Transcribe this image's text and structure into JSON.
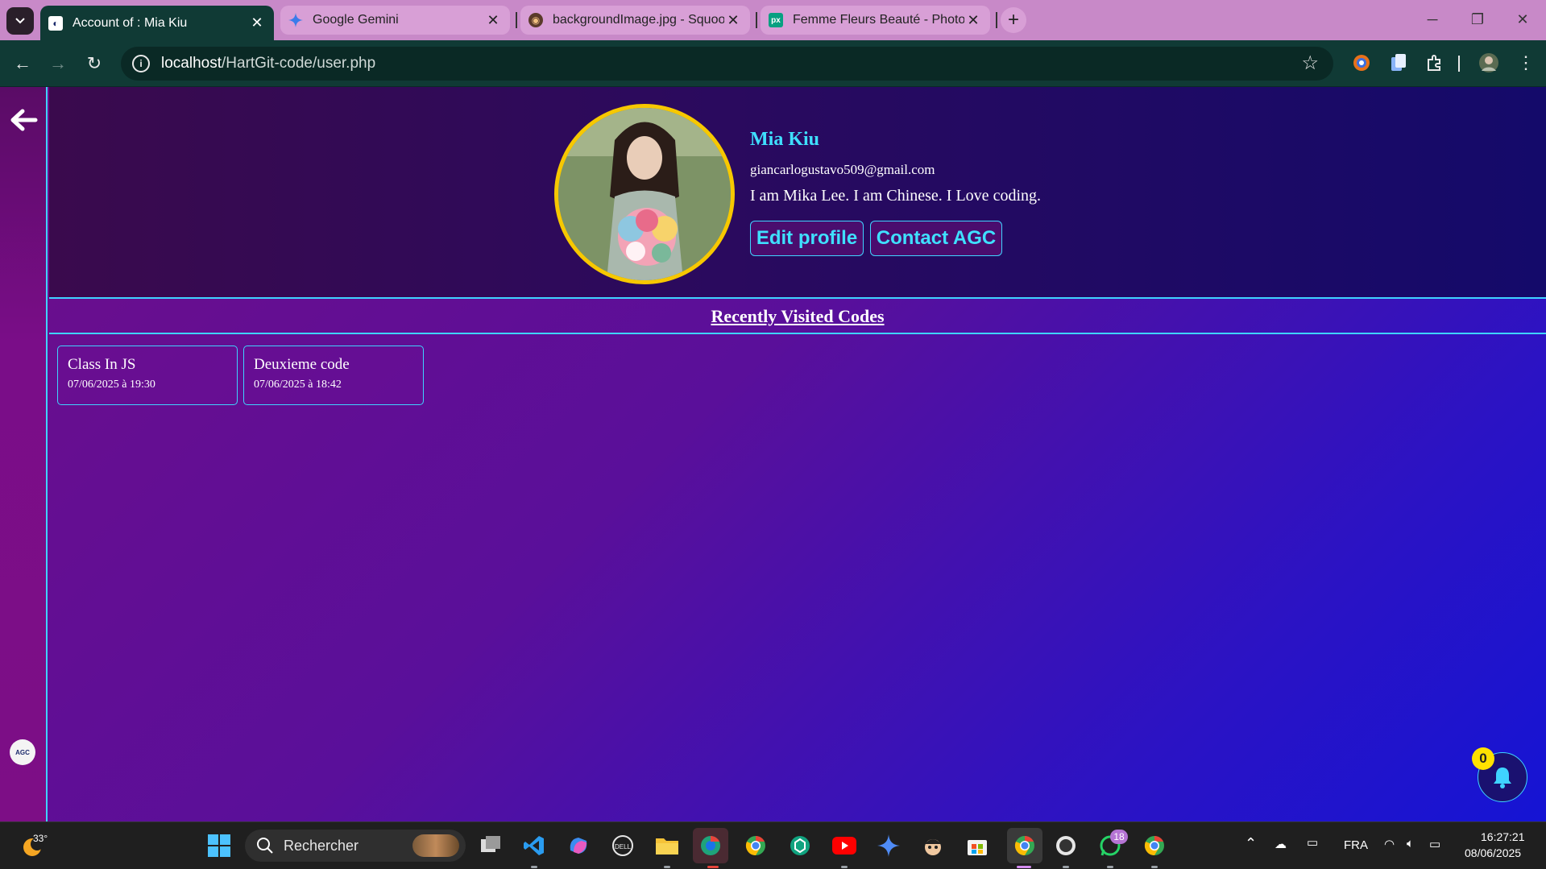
{
  "browser": {
    "tabs": [
      {
        "title": "Account of : Mia Kiu",
        "active": true,
        "favicon": "agc-favicon"
      },
      {
        "title": "Google Gemini",
        "active": false,
        "favicon": "gemini-sparkle-icon"
      },
      {
        "title": "backgroundImage.jpg - Squoosh",
        "active": false,
        "favicon": "squoosh-icon"
      },
      {
        "title": "Femme Fleurs Beauté - Photo g",
        "active": false,
        "favicon": "pexels-icon"
      }
    ],
    "url_host": "localhost",
    "url_path": "/HartGit-code/user.php"
  },
  "profile": {
    "name": "Mia Kiu",
    "email": "giancarlogustavo509@gmail.com",
    "bio": "I am Mika Lee. I am Chinese. I Love coding.",
    "edit_label": "Edit profile",
    "contact_label": "Contact AGC"
  },
  "recent": {
    "title": "Recently Visited Codes",
    "items": [
      {
        "name": "Class In JS",
        "date": "07/06/2025 à 19:30"
      },
      {
        "name": "Deuxieme code",
        "date": "07/06/2025 à 18:42"
      }
    ]
  },
  "sidebar": {
    "logo_text": "AGC"
  },
  "notifications": {
    "count": "0"
  },
  "taskbar": {
    "weather_temp": "33°",
    "search_label": "Rechercher",
    "language": "FRA",
    "time": "16:27:21",
    "date": "08/06/2025",
    "whatsapp_badge": "18"
  },
  "colors": {
    "accent": "#3fe0ff",
    "avatar_ring": "#f7c800",
    "badge": "#ffe200"
  }
}
